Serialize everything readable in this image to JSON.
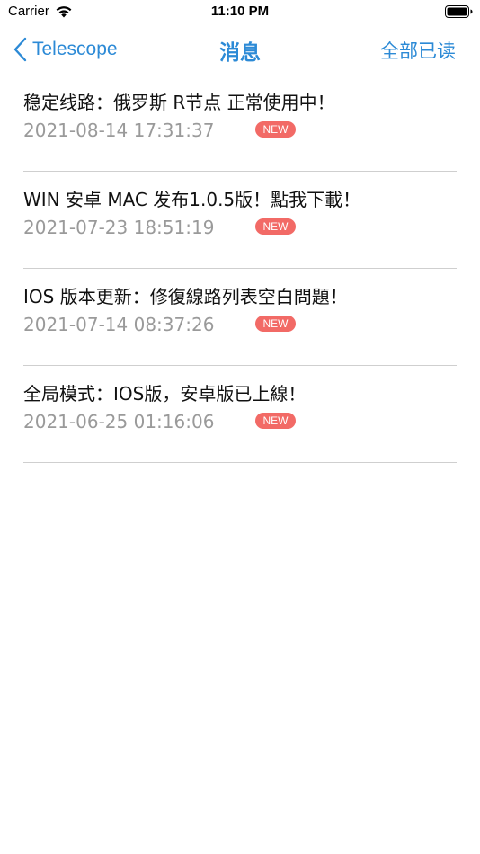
{
  "status_bar": {
    "carrier": "Carrier",
    "time": "11:10 PM"
  },
  "nav": {
    "back_label": "Telescope",
    "title": "消息",
    "mark_all_read": "全部已读",
    "accent_color": "#2c8ad6"
  },
  "messages": [
    {
      "title": "稳定线路：俄罗斯 R节点 正常使用中！",
      "date": "2021-08-14 17:31:37",
      "badge": "NEW"
    },
    {
      "title": "WIN 安卓 MAC 发布1.0.5版！點我下載！",
      "date": "2021-07-23 18:51:19",
      "badge": "NEW"
    },
    {
      "title": "IOS 版本更新：修復線路列表空白問題！",
      "date": "2021-07-14 08:37:26",
      "badge": "NEW"
    },
    {
      "title": "全局模式：IOS版，安卓版已上線！",
      "date": "2021-06-25 01:16:06",
      "badge": "NEW"
    }
  ],
  "icons": {
    "wifi": "wifi-icon",
    "battery": "battery-icon",
    "back": "chevron-left-icon"
  },
  "badge_color": "#f26a66"
}
